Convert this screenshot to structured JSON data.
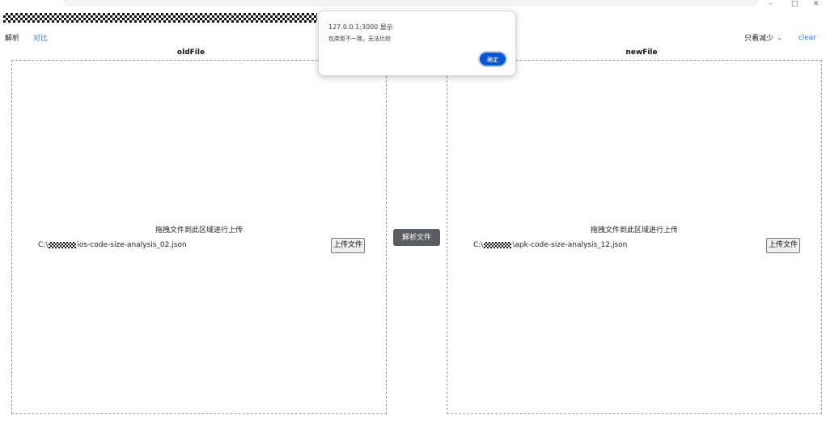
{
  "dialog": {
    "title": "127.0.0.1:3000 显示",
    "message": "包类型不一致，无法比较",
    "ok_label": "确定"
  },
  "nav": {
    "parse_label": "解析",
    "compare_label": "对比"
  },
  "filter": {
    "selected": "只看减少"
  },
  "clear_label": "clear",
  "old_panel": {
    "title": "oldFile",
    "hint": "拖拽文件到此区域进行上传",
    "path_prefix": "C:\\",
    "path_suffix": "ios-code-size-analysis_02.json",
    "upload_label": "上传文件"
  },
  "new_panel": {
    "title": "newFile",
    "hint": "拖拽文件到此区域进行上传",
    "path_prefix": "C:\\",
    "path_suffix": "\\apk-code-size-analysis_12.json",
    "upload_label": "上传文件"
  },
  "parse_button_label": "解析文件",
  "colors": {
    "link": "#3a78d6",
    "parse_button_bg": "#5a5d62",
    "dialog_ok_bg": "#0b57d0"
  }
}
